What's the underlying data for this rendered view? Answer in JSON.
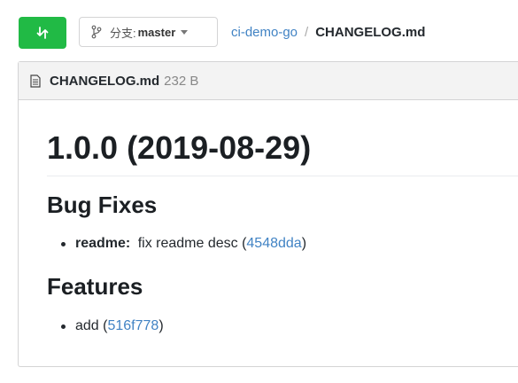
{
  "toolbar": {
    "branch_prefix": "分支:",
    "branch_name": "master"
  },
  "breadcrumb": {
    "repo": "ci-demo-go",
    "separator": "/",
    "file": "CHANGELOG.md"
  },
  "file_header": {
    "name": "CHANGELOG.md",
    "size": "232 B"
  },
  "content": {
    "title": "1.0.0 (2019-08-29)",
    "bug_fixes_heading": "Bug Fixes",
    "bug_fix_item": {
      "scope": "readme:",
      "text": " fix readme desc (",
      "commit": "4548dda",
      "close": ")"
    },
    "features_heading": "Features",
    "feature_item": {
      "text": "add (",
      "commit": "516f778",
      "close": ")"
    }
  },
  "colors": {
    "compare_button": "#21ba45",
    "link": "#4183c4"
  },
  "icons": {
    "compare": "compare-arrows-icon",
    "branch": "git-branch-icon",
    "file": "file-text-icon",
    "caret": "caret-down-icon"
  }
}
